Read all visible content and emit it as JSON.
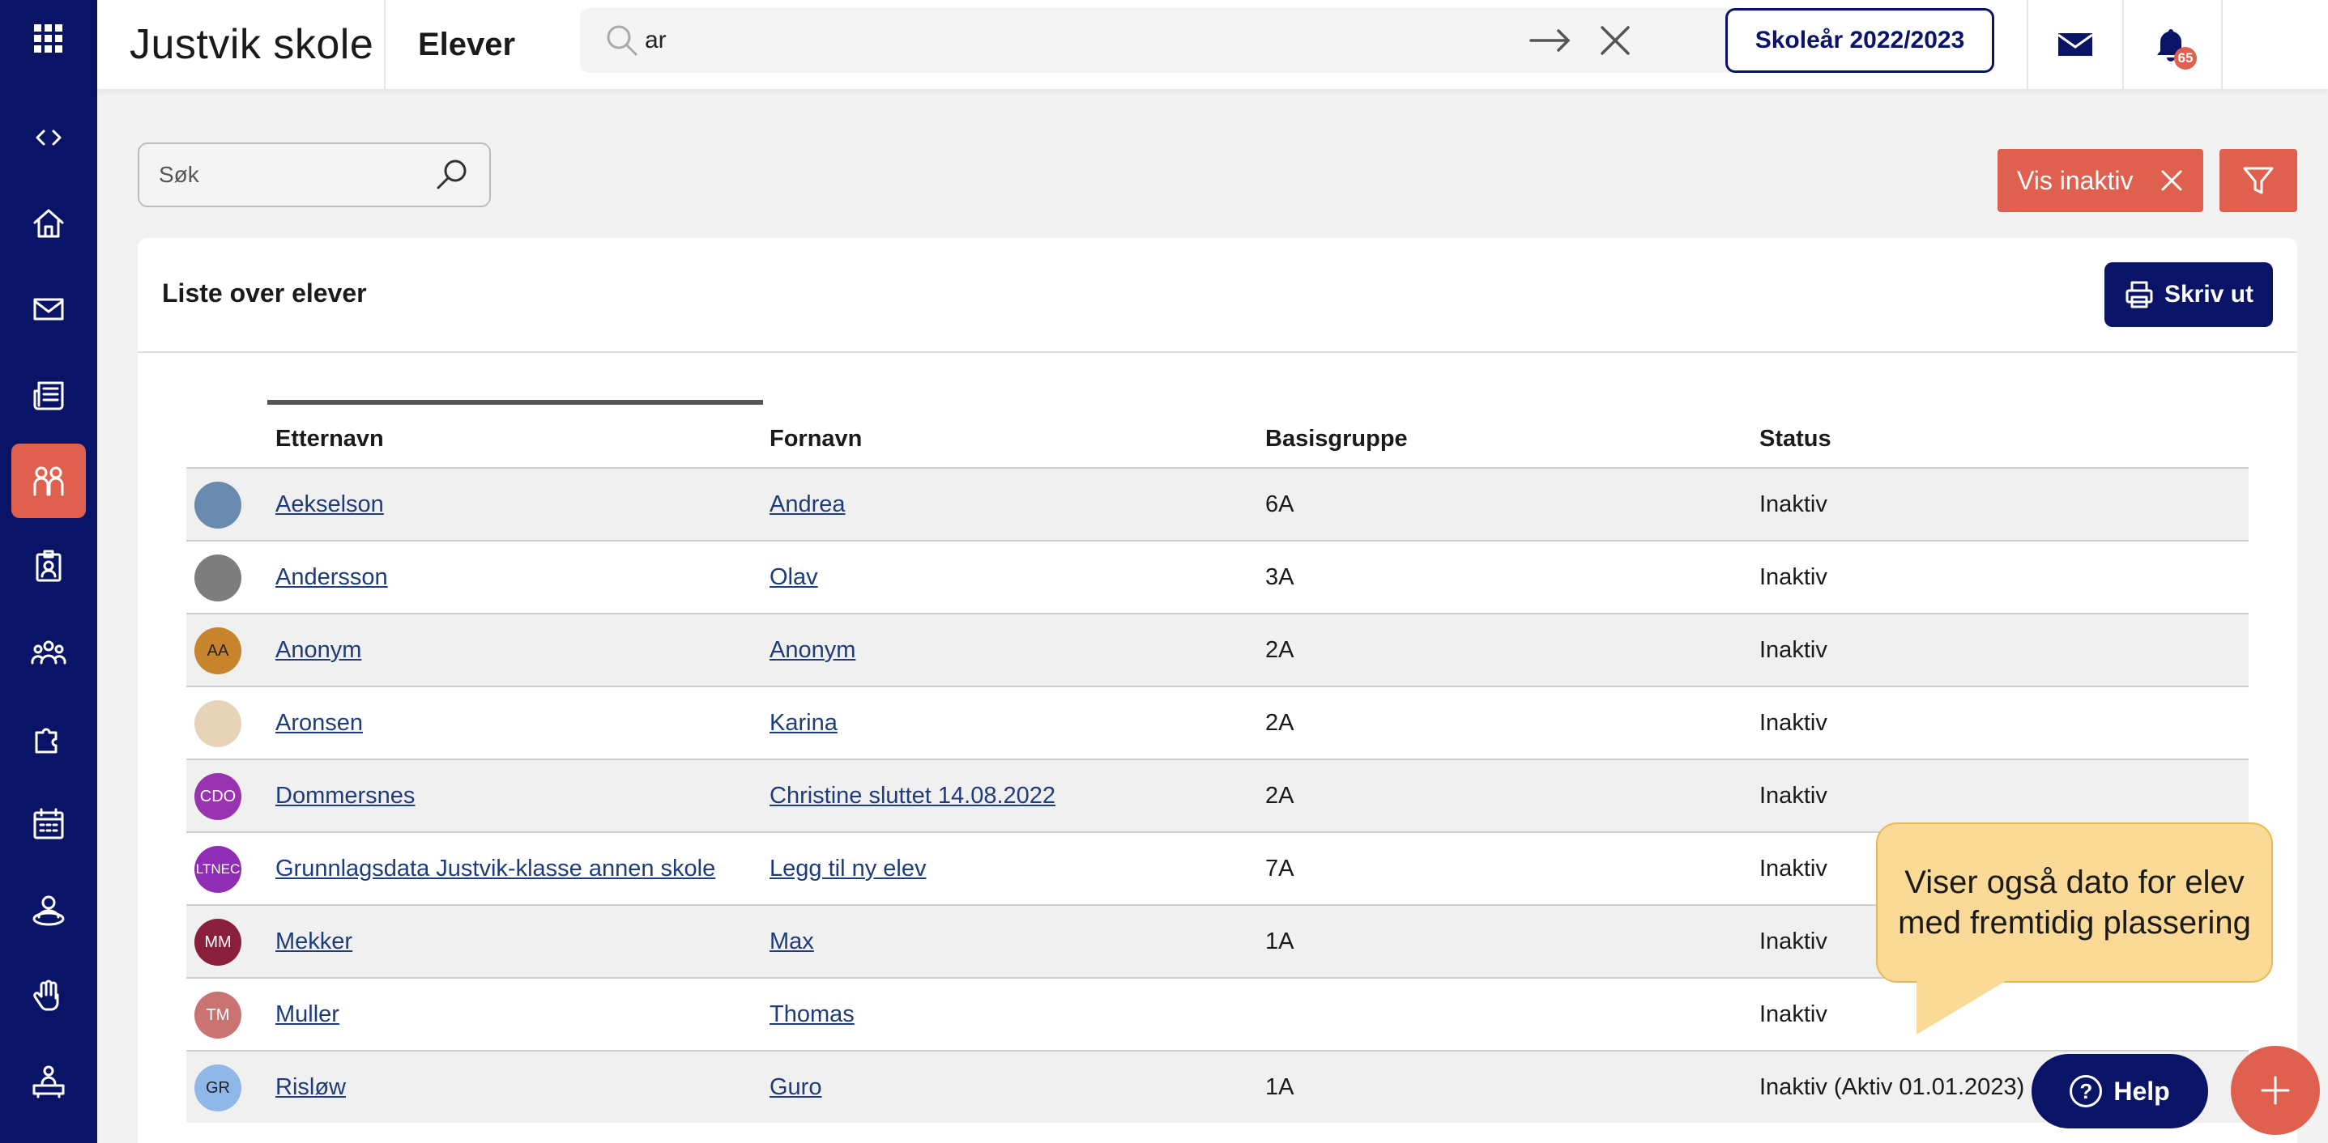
{
  "app": {
    "school_name": "Justvik skole",
    "page_title": "Elever",
    "school_year": "Skoleår 2022/2023",
    "notification_count": "65"
  },
  "global_search": {
    "value": "ar",
    "placeholder": ""
  },
  "sidebar": {
    "items": [
      {
        "icon": "grid-icon"
      },
      {
        "icon": "code-icon"
      },
      {
        "icon": "home-icon"
      },
      {
        "icon": "mail-icon"
      },
      {
        "icon": "newspaper-icon"
      },
      {
        "icon": "students-icon",
        "active": true
      },
      {
        "icon": "badge-icon"
      },
      {
        "icon": "group-icon"
      },
      {
        "icon": "puzzle-icon"
      },
      {
        "icon": "calendar-icon"
      },
      {
        "icon": "user-circle-icon"
      },
      {
        "icon": "hand-icon"
      },
      {
        "icon": "desk-icon"
      }
    ]
  },
  "filters": {
    "search_placeholder": "Søk",
    "inactive_label": "Vis inaktiv"
  },
  "list": {
    "title": "Liste over elever",
    "print_label": "Skriv ut",
    "columns": [
      "Etternavn",
      "Fornavn",
      "Basisgruppe",
      "Status"
    ],
    "rows": [
      {
        "initials": "",
        "avatar_color": "#6a8bb0",
        "last": "Aekselson",
        "first": "Andrea",
        "group": "6A",
        "status": "Inaktiv"
      },
      {
        "initials": "",
        "avatar_color": "#7d7d7d",
        "last": "Andersson",
        "first": "Olav",
        "group": "3A",
        "status": "Inaktiv"
      },
      {
        "initials": "AA",
        "avatar_color": "#c7842c",
        "last": "Anonym",
        "first": "Anonym",
        "group": "2A",
        "status": "Inaktiv"
      },
      {
        "initials": "",
        "avatar_color": "#e7d3b8",
        "last": "Aronsen",
        "first": "Karina",
        "group": "2A",
        "status": "Inaktiv"
      },
      {
        "initials": "CDO",
        "avatar_color": "#9933b0",
        "last": "Dommersnes",
        "first": "Christine sluttet 14.08.2022",
        "group": "2A",
        "status": "Inaktiv"
      },
      {
        "initials": "LTNEC",
        "avatar_color": "#8f2db5",
        "last": "Grunnlagsdata Justvik-klasse annen skole",
        "first": "Legg til ny elev",
        "group": "7A",
        "status": "Inaktiv"
      },
      {
        "initials": "MM",
        "avatar_color": "#8a1f3c",
        "last": "Mekker",
        "first": "Max",
        "group": "1A",
        "status": "Inaktiv"
      },
      {
        "initials": "TM",
        "avatar_color": "#c97373",
        "last": "Muller",
        "first": "Thomas",
        "group": "",
        "status": "Inaktiv"
      },
      {
        "initials": "GR",
        "avatar_color": "#8fb8e8",
        "last": "Risløw",
        "first": "Guro",
        "group": "1A",
        "status": "Inaktiv (Aktiv 01.01.2023)"
      }
    ]
  },
  "callout_text": "Viser også dato for elev med fremtidig plassering",
  "help_label": "Help",
  "colors": {
    "navy": "#0a1466",
    "accent": "#e0604f",
    "callout": "#fbd996"
  }
}
